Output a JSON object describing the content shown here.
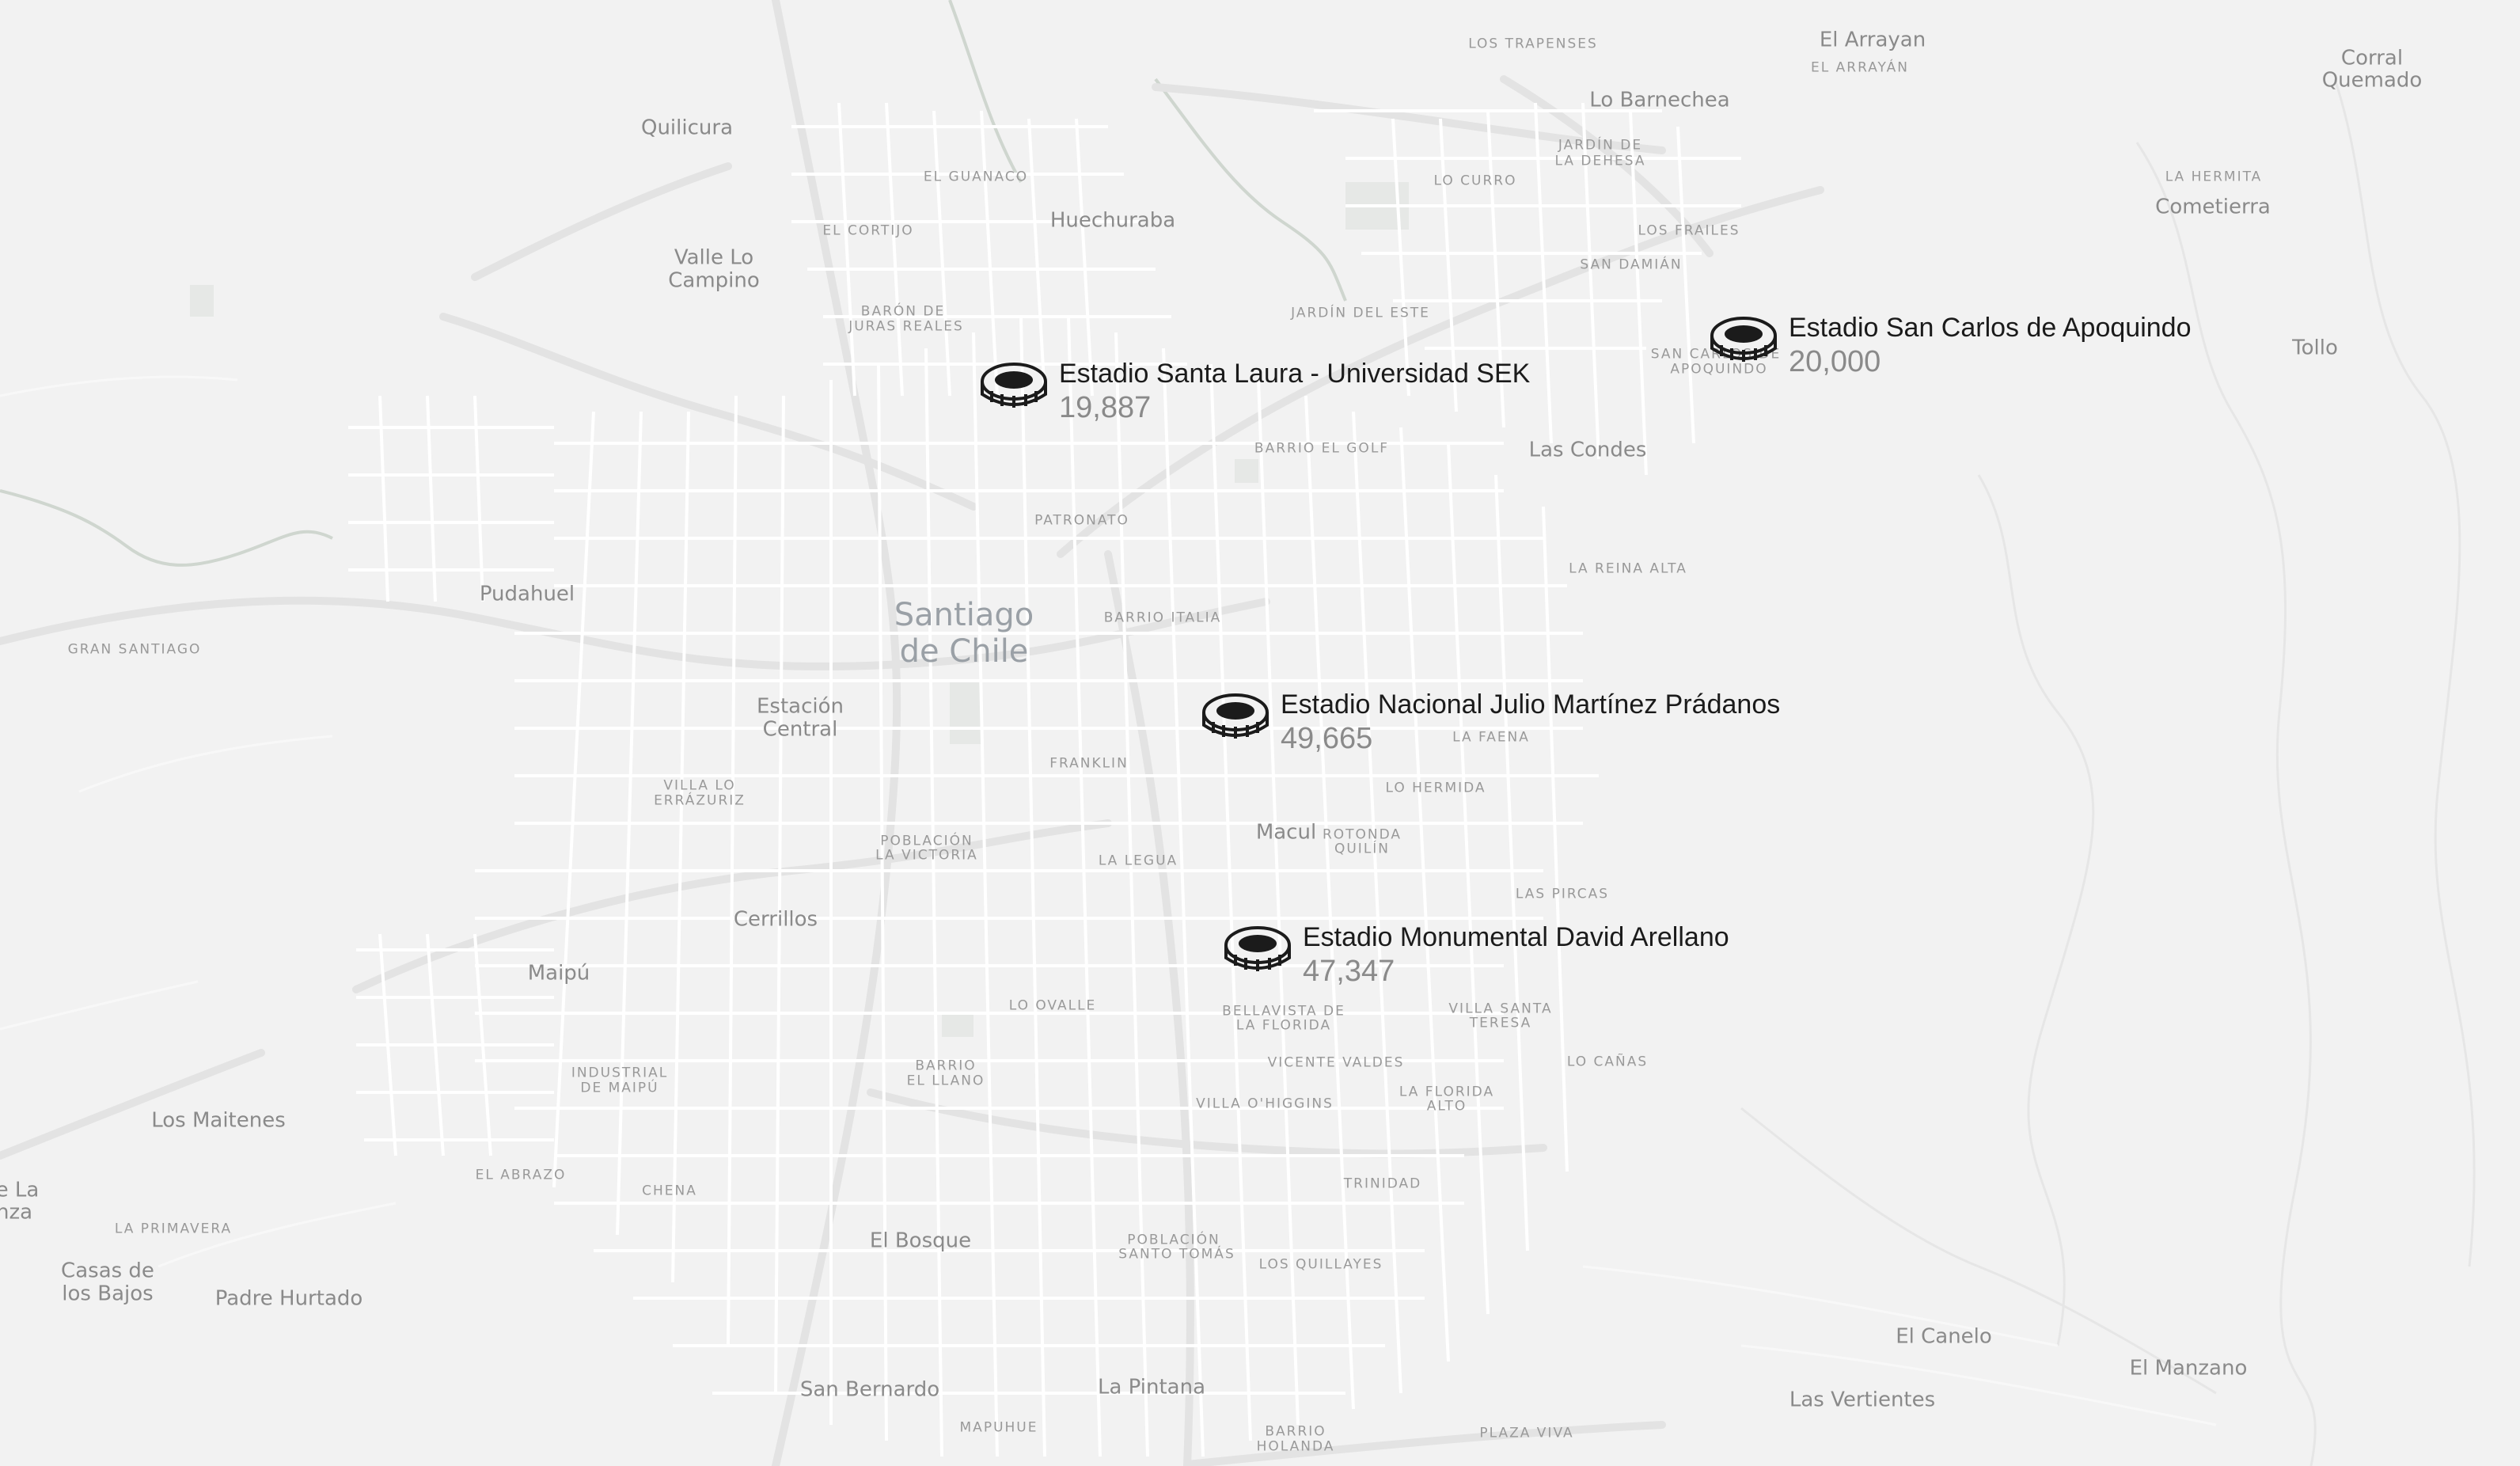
{
  "map": {
    "background": "#f2f2f2",
    "road_color": "#ffffff",
    "minor_road_color": "#fafafa",
    "river_color": "#c8d0c8",
    "park_color": "#e2e6e2"
  },
  "city": {
    "line1": "Santiago",
    "line2": "de Chile"
  },
  "places_medium": [
    "Quilicura",
    "Huechuraba",
    "Valle Lo",
    "Campino",
    "Pudahuel",
    "Estación",
    "Central",
    "Cerrillos",
    "Maipú",
    "Los Maitenes",
    "Casas de",
    "los Bajos",
    "Padre Hurtado",
    "El Bosque",
    "San Bernardo",
    "La Pintana",
    "Macul",
    "Las Condes",
    "Lo Barnechea",
    "El Arrayan",
    "Corral",
    "Quemado",
    "Cometierra",
    "Tollo",
    "El Canelo",
    "El Manzano",
    "Las Vertientes",
    "e La",
    "nza"
  ],
  "places_small": [
    "LOS TRAPENSES",
    "EL ARRAYÁN",
    "JARDÍN DE",
    "LA DEHESA",
    "LO CURRO",
    "LOS FRAILES",
    "SAN DAMIÁN",
    "LA HERMITA",
    "EL GUANACO",
    "EL CORTIJO",
    "BARÓN DE",
    "JURAS REALES",
    "JARDÍN DEL ESTE",
    "SAN CARLOS DE",
    "APOQUINDO",
    "BARRIO EL GOLF",
    "PATRONATO",
    "LA REINA ALTA",
    "BARRIO ITALIA",
    "GRAN SANTIAGO",
    "LA FAENA",
    "FRANKLIN",
    "LO HERMIDA",
    "VILLA LO",
    "ERRÁZURIZ",
    "ROTONDA",
    "QUILÍN",
    "POBLACIÓN",
    "LA VICTORIA",
    "LA LEGUA",
    "LAS PIRCAS",
    "LO OVALLE",
    "BELLAVISTA DE",
    "LA FLORIDA",
    "VILLA SANTA",
    "TERESA",
    "LO CAÑAS",
    "BARRIO",
    "EL LLANO",
    "VICENTE VALDES",
    "INDUSTRIAL",
    "DE MAIPÚ",
    "VILLA O'HIGGINS",
    "LA FLORIDA",
    "ALTO",
    "EL ABRAZO",
    "CHENA",
    "TRINIDAD",
    "LA PRIMAVERA",
    "POBLACIÓN",
    "SANTO TOMÁS",
    "LOS QUILLAYES",
    "MAPUHUE",
    "BARRIO",
    "HOLANDA",
    "PLAZA VIVA"
  ],
  "stadiums": [
    {
      "name": "Estadio Santa Laura - Universidad SEK",
      "capacity": "19,887",
      "icon": "stadium-icon"
    },
    {
      "name": "Estadio San Carlos de Apoquindo",
      "capacity": "20,000",
      "icon": "stadium-icon"
    },
    {
      "name": "Estadio Nacional Julio Martínez Prádanos",
      "capacity": "49,665",
      "icon": "stadium-icon"
    },
    {
      "name": "Estadio Monumental David Arellano",
      "capacity": "47,347",
      "icon": "stadium-icon"
    }
  ]
}
